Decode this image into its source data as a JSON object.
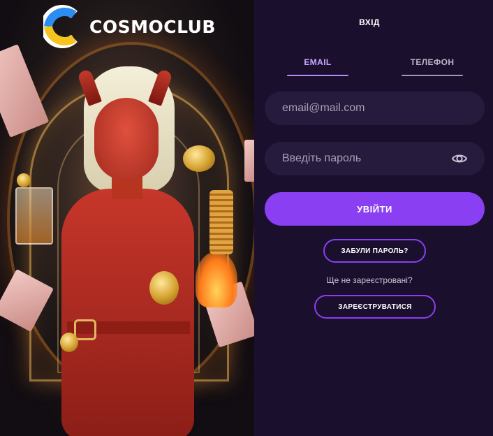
{
  "brand": {
    "logo_text": "COSMOCLUB"
  },
  "login": {
    "title": "ВХІД",
    "tabs": [
      {
        "label": "EMAIL",
        "active": true
      },
      {
        "label": "ТЕЛЕФОН",
        "active": false
      }
    ],
    "email_placeholder": "email@mail.com",
    "password_placeholder": "Введіть пароль",
    "submit_label": "УВІЙТИ",
    "forgot_label": "ЗАБУЛИ ПАРОЛЬ?",
    "not_registered_text": "Ще не зареєстровані?",
    "register_label": "ЗАРЕЄСТРУВАТИСЯ"
  },
  "colors": {
    "background": "#1b0f2e",
    "field_bg": "#271b3d",
    "accent": "#8a3ff2",
    "active_tab": "#c9a8ff"
  },
  "icons": {
    "password_toggle": "eye-icon"
  }
}
